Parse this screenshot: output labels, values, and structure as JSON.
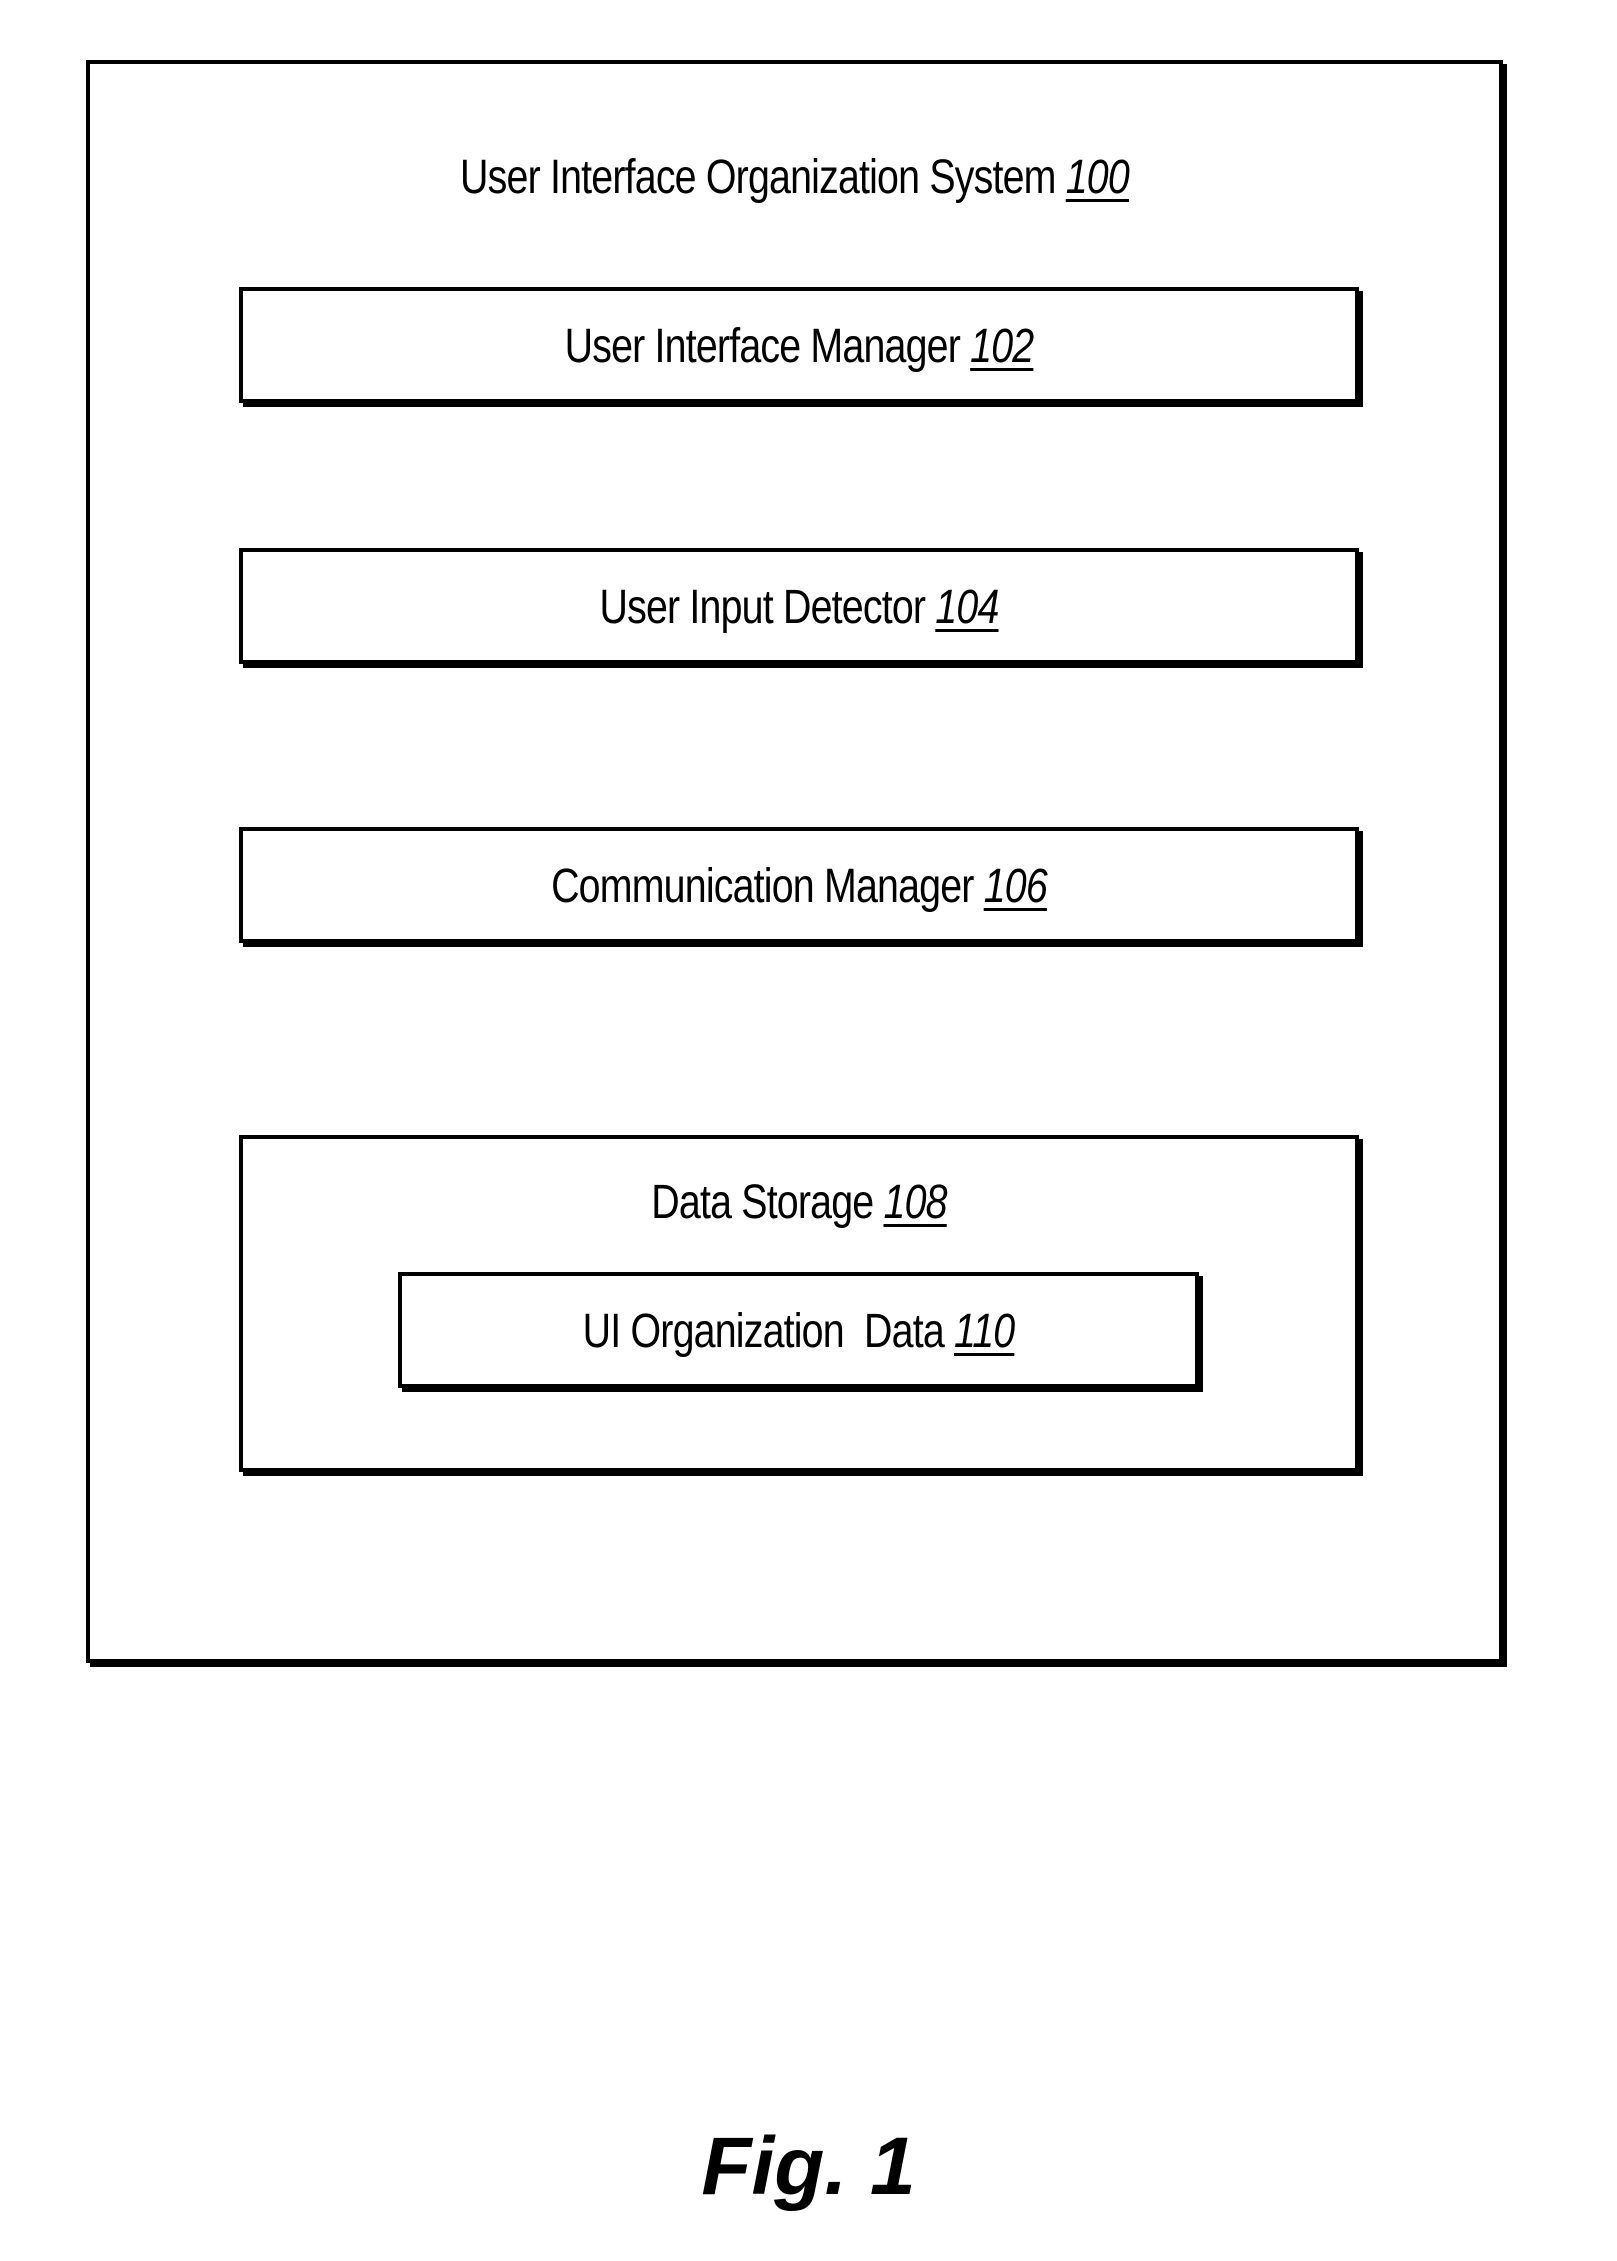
{
  "figure": {
    "caption": "Fig. 1",
    "system": {
      "name": "User Interface Organization System",
      "ref": "100"
    },
    "components": [
      {
        "name": "User Interface Manager",
        "ref": "102"
      },
      {
        "name": "User Input Detector",
        "ref": "104"
      },
      {
        "name": "Communication Manager",
        "ref": "106"
      }
    ],
    "storage": {
      "name": "Data Storage",
      "ref": "108",
      "contents": {
        "name": "UI Organization  Data",
        "ref": "110"
      }
    }
  }
}
